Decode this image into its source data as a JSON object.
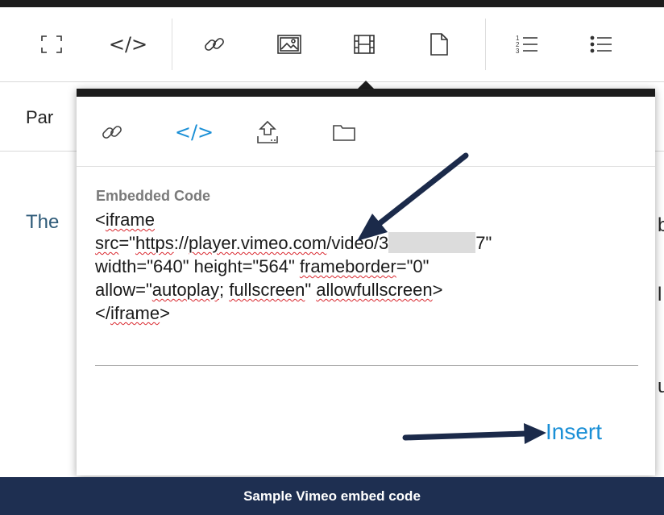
{
  "toolbar": {
    "items": [
      {
        "icon": "fullscreen-icon"
      },
      {
        "icon": "code-icon",
        "glyph": "</>"
      },
      {
        "icon": "link-icon"
      },
      {
        "icon": "image-icon"
      },
      {
        "icon": "film-icon"
      },
      {
        "icon": "file-icon"
      },
      {
        "icon": "ordered-list-icon"
      },
      {
        "icon": "unordered-list-icon"
      }
    ]
  },
  "row2": {
    "text": "Par"
  },
  "background": {
    "left_text": "The",
    "right_frag_1": "b",
    "right_frag_2": "l",
    "right_frag_3": "u"
  },
  "popup": {
    "tabs": [
      {
        "icon": "link-icon"
      },
      {
        "icon": "code-icon",
        "glyph": "</>",
        "active": true
      },
      {
        "icon": "upload-icon"
      },
      {
        "icon": "folder-icon"
      }
    ],
    "field_label": "Embedded Code",
    "code": {
      "l1_a": "<",
      "l1_b": "iframe",
      "l2_a": "src",
      "l2_b": "=\"",
      "l2_c": "https",
      "l2_d": "://",
      "l2_e": "player.vimeo.com",
      "l2_f": "/video/3",
      "l2_g": "7\"",
      "l3_a": "width=\"640\" height=\"564\" ",
      "l3_b": "frameborder",
      "l3_c": "=\"0\"",
      "l4_a": "allow=\"",
      "l4_b": "autoplay",
      "l4_c": "; ",
      "l4_d": "fullscreen",
      "l4_e": "\" ",
      "l4_f": "allowfullscreen",
      "l4_g": ">",
      "l5_a": "</",
      "l5_b": "iframe",
      "l5_c": ">"
    },
    "insert_label": "Insert"
  },
  "caption": "Sample Vimeo embed code",
  "colors": {
    "accent": "#1a8fd6",
    "footer": "#1e2f51",
    "arrow": "#1b2a4a",
    "spell": "#d9272e"
  }
}
